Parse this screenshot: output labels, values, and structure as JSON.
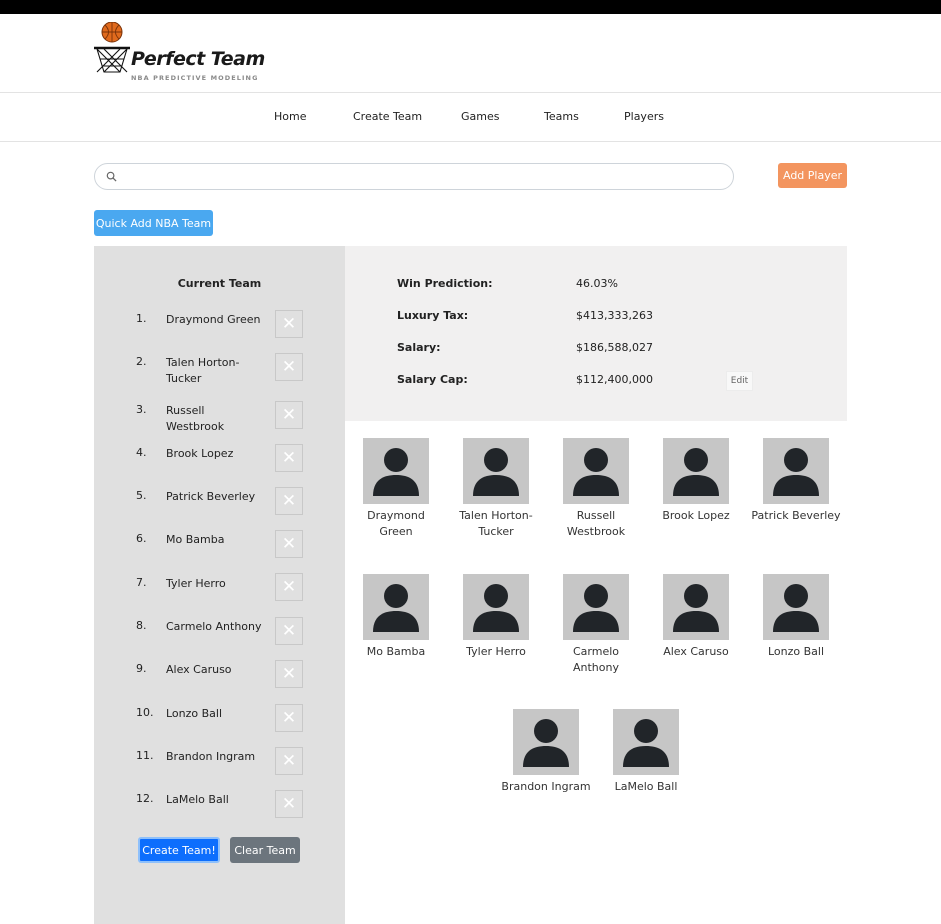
{
  "brand": {
    "title": "Perfect Team",
    "subtitle": "NBA PREDICTIVE MODELING"
  },
  "nav": {
    "items": [
      "Home",
      "Create Team",
      "Games",
      "Teams",
      "Players"
    ]
  },
  "search": {
    "placeholder": "",
    "value": ""
  },
  "actions": {
    "add_player": "Add Player",
    "quick_add": "Quick Add NBA Team",
    "create_team": "Create Team!",
    "clear_team": "Clear Team"
  },
  "current_team": {
    "title": "Current Team",
    "players": [
      {
        "num": "1.",
        "name": "Draymond Green"
      },
      {
        "num": "2.",
        "name": "Talen Horton-Tucker"
      },
      {
        "num": "3.",
        "name": "Russell Westbrook"
      },
      {
        "num": "4.",
        "name": "Brook Lopez"
      },
      {
        "num": "5.",
        "name": "Patrick Beverley"
      },
      {
        "num": "6.",
        "name": "Mo Bamba"
      },
      {
        "num": "7.",
        "name": "Tyler Herro"
      },
      {
        "num": "8.",
        "name": "Carmelo Anthony"
      },
      {
        "num": "9.",
        "name": "Alex Caruso"
      },
      {
        "num": "10.",
        "name": "Lonzo Ball"
      },
      {
        "num": "11.",
        "name": "Brandon Ingram"
      },
      {
        "num": "12.",
        "name": "LaMelo Ball"
      }
    ],
    "remove_glyph": "✕"
  },
  "stats": {
    "win_prediction": {
      "label": "Win Prediction:",
      "value": "46.03%"
    },
    "luxury_tax": {
      "label": "Luxury Tax:",
      "value": "$413,333,263"
    },
    "salary": {
      "label": "Salary:",
      "value": "$186,588,027"
    },
    "salary_cap": {
      "label": "Salary Cap:",
      "value": "$112,400,000"
    },
    "edit_label": "Edit"
  },
  "player_grid": [
    {
      "name": "Draymond Green"
    },
    {
      "name": "Talen Horton-Tucker"
    },
    {
      "name": "Russell Westbrook"
    },
    {
      "name": "Brook Lopez"
    },
    {
      "name": "Patrick Beverley"
    },
    {
      "name": "Mo Bamba"
    },
    {
      "name": "Tyler Herro"
    },
    {
      "name": "Carmelo Anthony"
    },
    {
      "name": "Alex Caruso"
    },
    {
      "name": "Lonzo Ball"
    },
    {
      "name": "Brandon Ingram"
    },
    {
      "name": "LaMelo Ball"
    }
  ],
  "icons": {
    "logo": "basketball-hoop-icon",
    "search": "search-icon",
    "remove": "close-icon",
    "avatar": "person-silhouette-icon"
  },
  "colors": {
    "add_player": "#f3955f",
    "quick_add": "#4aa8f0",
    "create_team": "#0d6efd",
    "clear_team": "#6c757d",
    "left_panel": "#e0e0e0",
    "stats_panel": "#f1f0f0",
    "avatar_bg": "#c6c6c6",
    "ball": "#e06a1d"
  }
}
